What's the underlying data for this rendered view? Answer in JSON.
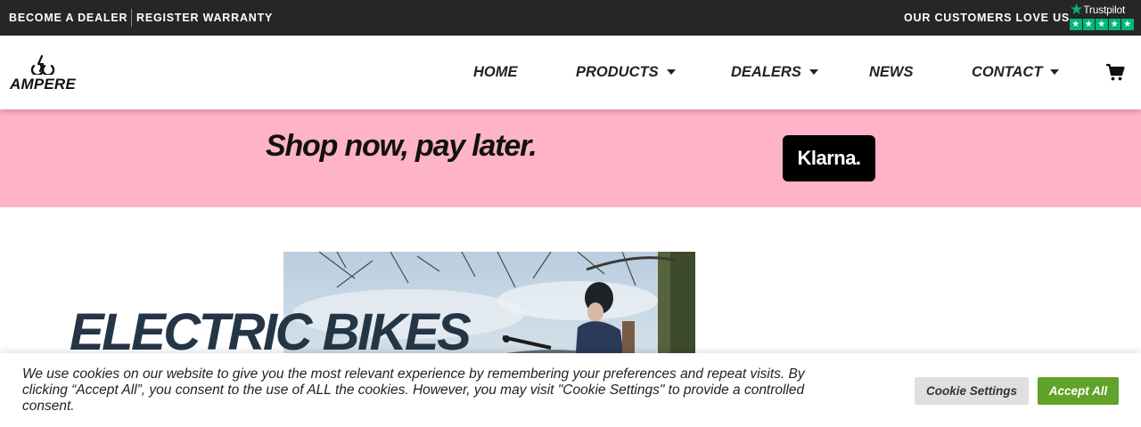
{
  "topbar": {
    "links": [
      "BECOME A DEALER",
      "REGISTER WARRANTY"
    ],
    "tagline": "OUR CUSTOMERS LOVE US",
    "trustpilot": {
      "label": "Trustpilot",
      "rating_stars": 5,
      "icon": "trustpilot-star-icon",
      "color": "#00b67a"
    }
  },
  "header": {
    "logo_text": "AMPERE",
    "nav": {
      "home": "HOME",
      "products": "PRODUCTS",
      "dealers": "DEALERS",
      "news": "NEWS",
      "contact": "CONTACT"
    },
    "cart_icon": "shopping-cart-icon"
  },
  "klarna_banner": {
    "text": "Shop now, pay later.",
    "badge": "Klarna.",
    "background": "#ffb3c7"
  },
  "hero": {
    "title": "ELECTRIC BIKES",
    "title_color": "#243646"
  },
  "cookie_bar": {
    "message": "We use cookies on our website to give you the most relevant experience by remembering your preferences and repeat visits. By clicking “Accept All”, you consent to the use of ALL the cookies. However, you may visit \"Cookie Settings\" to provide a controlled consent.",
    "settings_label": "Cookie Settings",
    "accept_label": "Accept All",
    "accept_color": "#61a229"
  }
}
